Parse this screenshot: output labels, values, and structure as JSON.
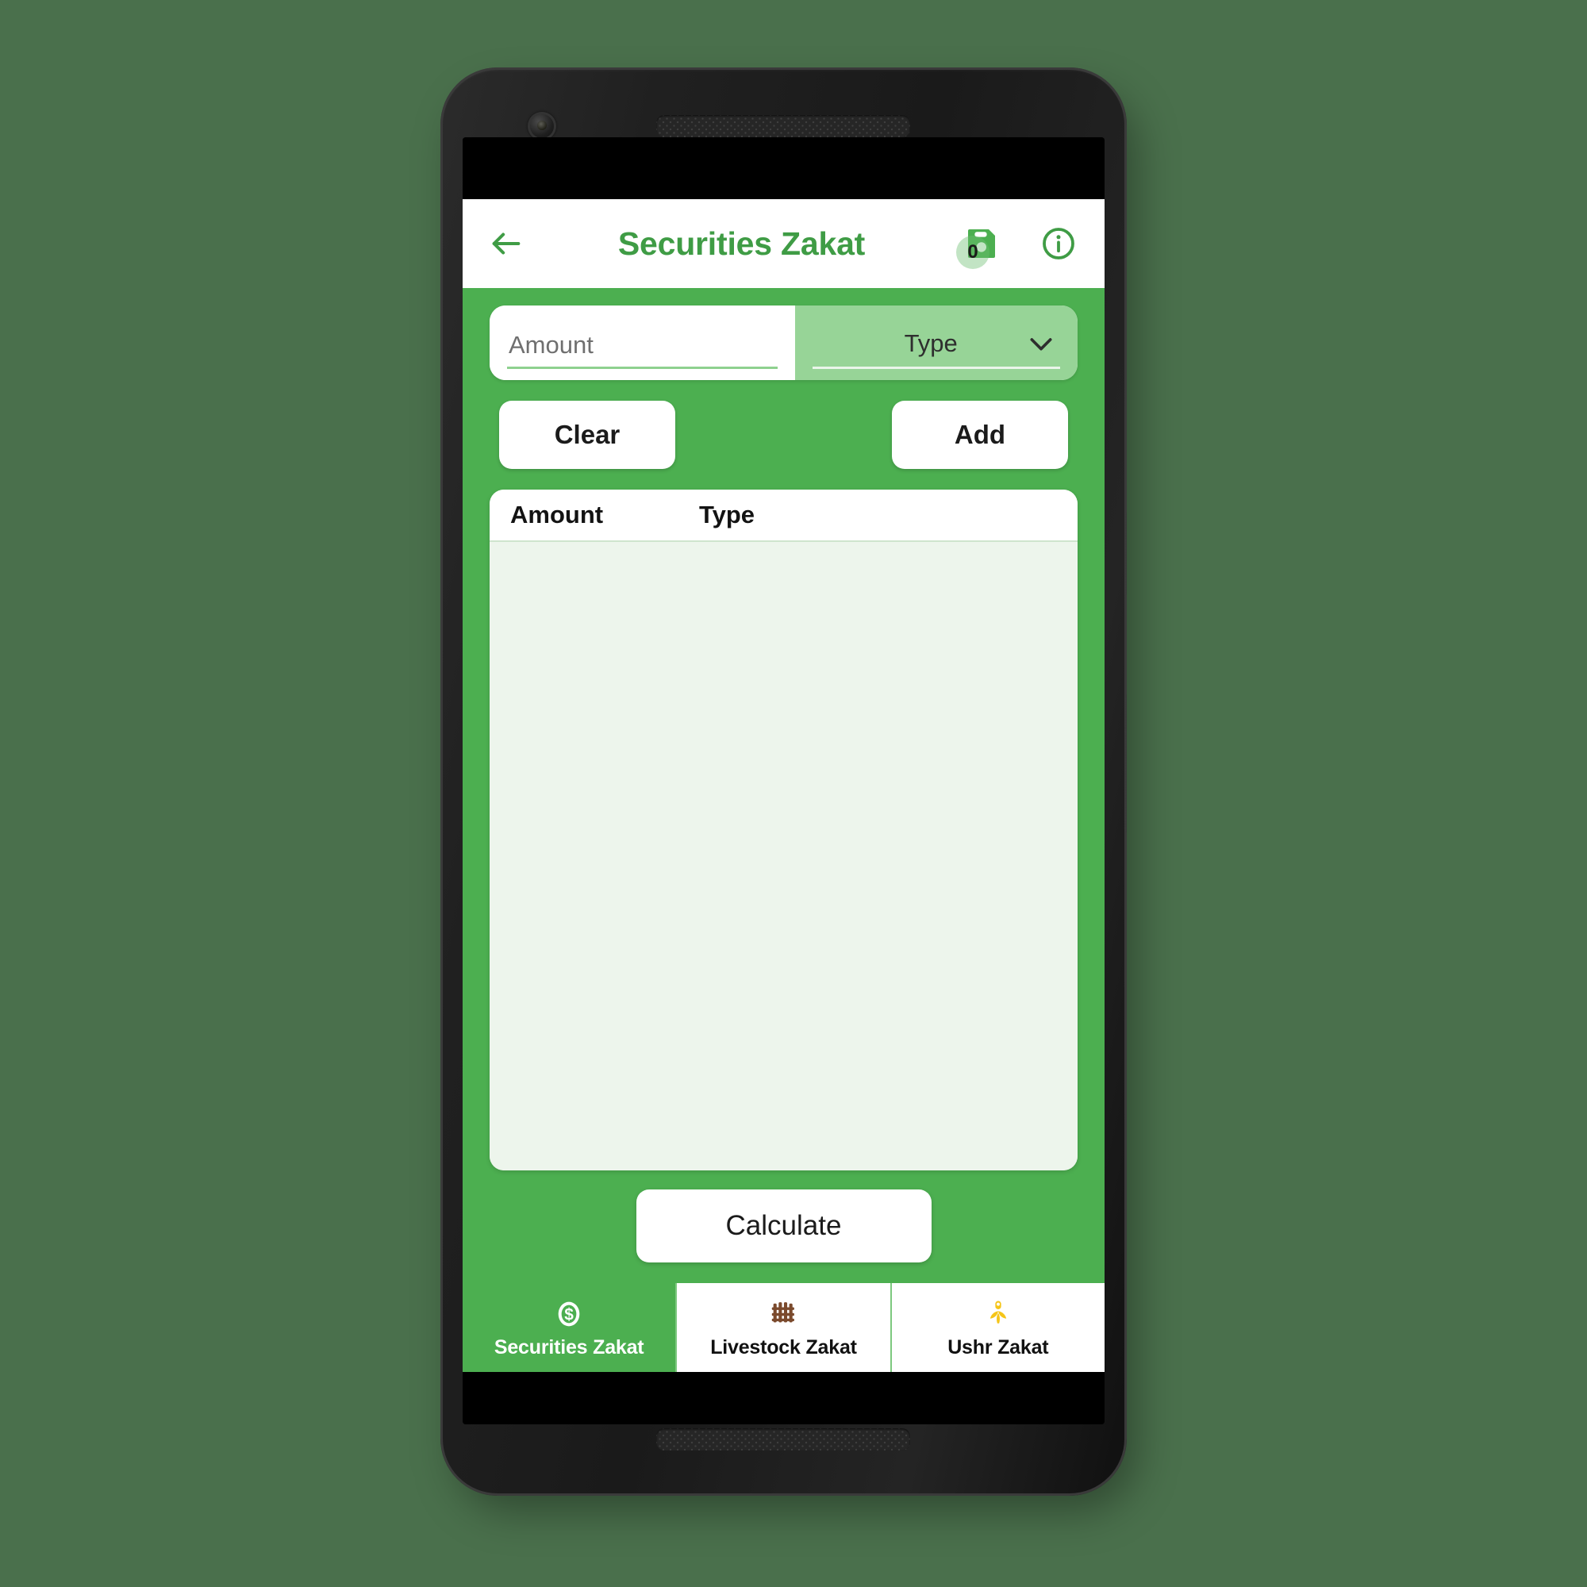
{
  "theme": {
    "page_background": "#4a704c",
    "app_green": "#4CAF50",
    "app_green_light": "#97D497",
    "title_green": "#3F9C45",
    "table_bg": "#EDF5EC",
    "livestock_icon_color": "#7B4A2D",
    "ushr_icon_color": "#F5C518"
  },
  "appbar": {
    "back_icon": "arrow-left-icon",
    "title": "Securities Zakat",
    "save_icon": "floppy-save-icon",
    "save_badge_count": "0",
    "info_icon": "info-circle-icon"
  },
  "form": {
    "amount": {
      "value": "",
      "placeholder": "Amount"
    },
    "type": {
      "selected": "Type",
      "chevron_icon": "chevron-down-icon"
    },
    "clear_label": "Clear",
    "add_label": "Add"
  },
  "table": {
    "columns": [
      "Amount",
      "Type"
    ],
    "rows": []
  },
  "actions": {
    "calculate_label": "Calculate"
  },
  "bottom_nav": {
    "items": [
      {
        "label": "Securities Zakat",
        "icon": "dollar-coin-icon",
        "active": true
      },
      {
        "label": "Livestock Zakat",
        "icon": "livestock-fence-icon",
        "active": false
      },
      {
        "label": "Ushr Zakat",
        "icon": "wheat-grain-icon",
        "active": false
      }
    ]
  }
}
